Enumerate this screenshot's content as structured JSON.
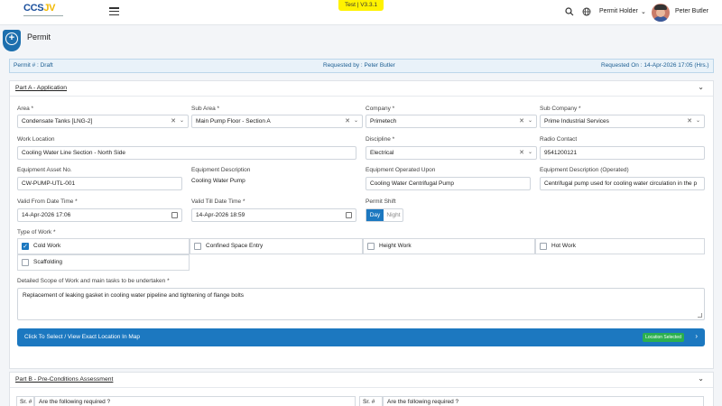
{
  "header": {
    "logo": {
      "primary": "CCS",
      "accent": "JV"
    },
    "version": "Test | V3.3.1",
    "role": "Permit Holder",
    "user_name": "Peter Butler",
    "icons": [
      "search-icon",
      "globe-icon",
      "chevron-down-icon"
    ]
  },
  "page": {
    "title": "Permit",
    "icon": "plus-circle-icon"
  },
  "info_bar": {
    "permit": "Permit # : Draft",
    "requested_by": "Requested by : Peter Butler",
    "requested_on": "Requested On : 14-Apr-2026 17:05 (Hrs.)"
  },
  "part_a": {
    "title": "Part A - Application",
    "area": {
      "label": "Area *",
      "value": "Condensate Tanks [LNG-2]"
    },
    "sub_area": {
      "label": "Sub Area *",
      "value": "Main Pump Floor - Section A"
    },
    "company": {
      "label": "Company *",
      "value": "Primetech"
    },
    "sub_company": {
      "label": "Sub Company *",
      "value": "Prime Industrial Services"
    },
    "work_location": {
      "label": "Work Location",
      "value": "Cooling Water Line Section - North Side"
    },
    "discipline": {
      "label": "Discipline *",
      "value": "Electrical"
    },
    "radio_contact": {
      "label": "Radio Contact",
      "value": "9541200121"
    },
    "asset_no": {
      "label": "Equipment Asset No.",
      "value": "CW-PUMP-UTL-001"
    },
    "equip_desc": {
      "label": "Equipment Description",
      "value": "Cooling Water Pump"
    },
    "operated_upon": {
      "label": "Equipment Operated Upon",
      "value": "Cooling Water Centrifugal Pump"
    },
    "equip_desc_operated": {
      "label": "Equipment Description (Operated)",
      "value": "Centrifugal pump used for cooling water circulation in the p"
    },
    "valid_from": {
      "label": "Valid From Date Time *",
      "value": "14-Apr-2026 17:06"
    },
    "valid_till": {
      "label": "Valid Till Date Time *",
      "value": "14-Apr-2026 18:59"
    },
    "shift": {
      "label": "Permit Shift",
      "options": [
        "Day",
        "Night"
      ],
      "selected": "Day"
    },
    "type_of_work": {
      "label": "Type of Work *",
      "items": [
        {
          "label": "Cold Work",
          "checked": true
        },
        {
          "label": "Confined Space Entry",
          "checked": false
        },
        {
          "label": "Height Work",
          "checked": false
        },
        {
          "label": "Hot Work",
          "checked": false
        },
        {
          "label": "Scaffolding",
          "checked": false
        }
      ]
    },
    "scope": {
      "label": "Detailed Scope of Work and main tasks to be undertaken *",
      "value": "Replacement of leaking gasket in cooling water pipeline and tightening of flange bolts"
    },
    "map": {
      "label": "Click To Select / View Exact Location In Map",
      "badge": "Location Selected"
    }
  },
  "part_b": {
    "title": "Part B - Pre-Conditions Assessment",
    "columns": [
      "Sr. #",
      "Are the following required ?",
      "Sr. #",
      "Are the following required ?"
    ]
  },
  "colors": {
    "primary": "#1c78c0",
    "badge": "#2bb04f",
    "version_bg": "#fff200"
  }
}
